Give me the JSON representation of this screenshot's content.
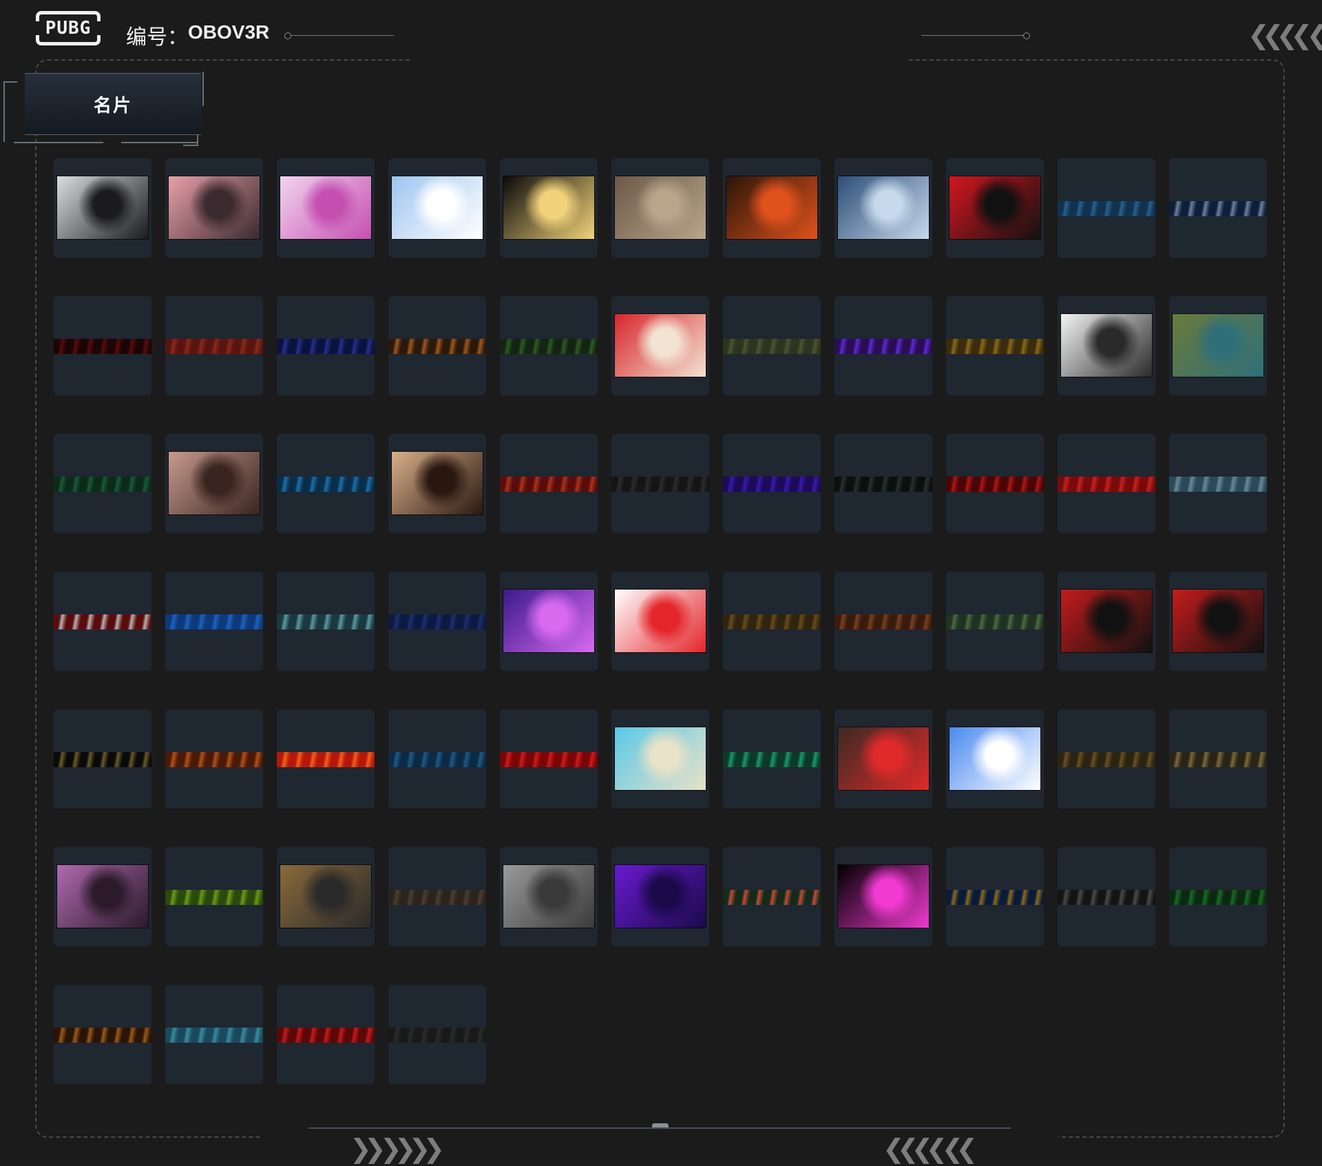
{
  "header": {
    "logo_text": "PUBG",
    "id_label": "编号：",
    "id_value": "OBOV3R",
    "top_right_chevrons": "❮❮❮❮ ❮"
  },
  "tab": {
    "label": "名片"
  },
  "footer": {
    "left_chevrons": "❯❯ ❯❯❯❯",
    "right_chevrons": "❮❮❮❮ ❮❮"
  },
  "cards": [
    {
      "style": "full",
      "colors": [
        "#d9dde0",
        "#1a1a1f"
      ],
      "icon": "girl-portrait"
    },
    {
      "style": "full",
      "colors": [
        "#e8a0a8",
        "#3b2a2f"
      ],
      "icon": "pink-hair-portrait"
    },
    {
      "style": "full",
      "colors": [
        "#f3d5ef",
        "#c44fb0"
      ],
      "icon": "flower-pattern"
    },
    {
      "style": "full",
      "colors": [
        "#9ec5f0",
        "#ffffff"
      ],
      "icon": "cartoon-fox"
    },
    {
      "style": "full",
      "colors": [
        "#0a0a0a",
        "#f2d27a"
      ],
      "icon": "anime-girls"
    },
    {
      "style": "full",
      "colors": [
        "#6b5a48",
        "#b9a58a"
      ],
      "icon": "soldier-gun"
    },
    {
      "style": "full",
      "colors": [
        "#2a1608",
        "#e0521d"
      ],
      "icon": "glowing-fruit"
    },
    {
      "style": "full",
      "colors": [
        "#2c4e78",
        "#c7d9ec"
      ],
      "icon": "snow-village"
    },
    {
      "style": "full",
      "colors": [
        "#d4161f",
        "#111111"
      ],
      "icon": "chained-wolf"
    },
    {
      "style": "strip",
      "colors": [
        "#0f3350",
        "#2a6088"
      ]
    },
    {
      "style": "strip",
      "colors": [
        "#0d1f3a",
        "#6f7f9c"
      ]
    },
    {
      "style": "strip",
      "colors": [
        "#1a0606",
        "#5c0b0b"
      ]
    },
    {
      "style": "strip",
      "colors": [
        "#5a1410",
        "#8a2a1a"
      ]
    },
    {
      "style": "strip",
      "colors": [
        "#0b1240",
        "#25308a"
      ]
    },
    {
      "style": "strip",
      "colors": [
        "#2a1a0c",
        "#a2561e"
      ]
    },
    {
      "style": "strip",
      "colors": [
        "#132412",
        "#2d5a22"
      ]
    },
    {
      "style": "full",
      "colors": [
        "#d8262b",
        "#f2e3d3"
      ],
      "icon": "octopus"
    },
    {
      "style": "strip",
      "colors": [
        "#2c3420",
        "#4a5530"
      ]
    },
    {
      "style": "strip",
      "colors": [
        "#2a0e55",
        "#5b2ad0"
      ]
    },
    {
      "style": "strip",
      "colors": [
        "#3a2c0c",
        "#8a6a1a"
      ]
    },
    {
      "style": "full",
      "colors": [
        "#f4f4f4",
        "#2a2a2a"
      ],
      "icon": "sketch-man-gun"
    },
    {
      "style": "full",
      "colors": [
        "#6a7a3a",
        "#2f6f7a"
      ],
      "icon": "frog-warrior"
    },
    {
      "style": "strip",
      "colors": [
        "#0c2a1a",
        "#1a5a34"
      ]
    },
    {
      "style": "full",
      "colors": [
        "#c79a8e",
        "#3a2420"
      ],
      "icon": "woman-sunglasses"
    },
    {
      "style": "strip",
      "colors": [
        "#0a2e4a",
        "#1a6fa8"
      ]
    },
    {
      "style": "full",
      "colors": [
        "#d9b08a",
        "#2a1810"
      ],
      "icon": "sniper-silhouette"
    },
    {
      "style": "strip",
      "colors": [
        "#5a0c0c",
        "#a8341c"
      ]
    },
    {
      "style": "strip",
      "colors": [
        "#151515",
        "#2c2c2c"
      ]
    },
    {
      "style": "strip",
      "colors": [
        "#1c0a5a",
        "#3a1aa8"
      ]
    },
    {
      "style": "strip",
      "colors": [
        "#0b0f10",
        "#25332c"
      ]
    },
    {
      "style": "strip",
      "colors": [
        "#4a0606",
        "#b01616"
      ]
    },
    {
      "style": "strip",
      "colors": [
        "#7a0a0a",
        "#c42222"
      ]
    },
    {
      "style": "strip",
      "colors": [
        "#2a4a5a",
        "#6a8a9a"
      ]
    },
    {
      "style": "strip",
      "colors": [
        "#5a0c0c",
        "#b8b0b0"
      ]
    },
    {
      "style": "strip",
      "colors": [
        "#0c3a7a",
        "#2160c0"
      ]
    },
    {
      "style": "strip",
      "colors": [
        "#1a3a40",
        "#5a9aa0"
      ]
    },
    {
      "style": "strip",
      "colors": [
        "#0c1a40",
        "#1c2e70"
      ]
    },
    {
      "style": "full",
      "colors": [
        "#3a1a8a",
        "#d86af0"
      ],
      "icon": "neon-car"
    },
    {
      "style": "full",
      "colors": [
        "#ffffff",
        "#e3262b"
      ],
      "icon": "rc-car"
    },
    {
      "style": "strip",
      "colors": [
        "#2e2410",
        "#6a4c1a"
      ]
    },
    {
      "style": "strip",
      "colors": [
        "#3a1a0c",
        "#7a4020"
      ]
    },
    {
      "style": "strip",
      "colors": [
        "#1f3320",
        "#4a6a44"
      ]
    },
    {
      "style": "full",
      "colors": [
        "#c41c1c",
        "#111111"
      ],
      "icon": "black-wolves"
    },
    {
      "style": "full",
      "colors": [
        "#c41c1c",
        "#111111"
      ],
      "icon": "good-luck-wolf"
    },
    {
      "style": "strip",
      "colors": [
        "#0a0a0a",
        "#6a5a2a"
      ]
    },
    {
      "style": "strip",
      "colors": [
        "#4a1a06",
        "#b4501c"
      ]
    },
    {
      "style": "strip",
      "colors": [
        "#b4180c",
        "#f2601a"
      ]
    },
    {
      "style": "strip",
      "colors": [
        "#0c2a44",
        "#1e5a88"
      ]
    },
    {
      "style": "strip",
      "colors": [
        "#7a0606",
        "#d01a1a"
      ]
    },
    {
      "style": "full",
      "colors": [
        "#5ac8e8",
        "#e8e2c8"
      ],
      "icon": "seagull"
    },
    {
      "style": "strip",
      "colors": [
        "#0c3a2a",
        "#1a9a6a"
      ]
    },
    {
      "style": "full",
      "colors": [
        "#3a2a22",
        "#e02a2a"
      ],
      "icon": "plague-doctor"
    },
    {
      "style": "full",
      "colors": [
        "#4a8af0",
        "#ffffff"
      ],
      "icon": "pixel-cat"
    },
    {
      "style": "strip",
      "colors": [
        "#2a2412",
        "#6a5020"
      ]
    },
    {
      "style": "strip",
      "colors": [
        "#2a2416",
        "#7a6a3a"
      ]
    },
    {
      "style": "full",
      "colors": [
        "#b06ab0",
        "#2a1a2a"
      ],
      "icon": "purple-face"
    },
    {
      "style": "strip",
      "colors": [
        "#2a4a0c",
        "#6a9a1a"
      ]
    },
    {
      "style": "full",
      "colors": [
        "#8a6a3a",
        "#2a2a2a"
      ],
      "icon": "winner-dinner"
    },
    {
      "style": "strip",
      "colors": [
        "#2a241c",
        "#4a3e30"
      ]
    },
    {
      "style": "full",
      "colors": [
        "#9a9a9a",
        "#3a3a3a"
      ],
      "icon": "static-figure"
    },
    {
      "style": "full",
      "colors": [
        "#6a1ad0",
        "#1a0a4a"
      ],
      "icon": "hooded-figure"
    },
    {
      "style": "strip",
      "colors": [
        "#142a1a",
        "#c04a3a"
      ]
    },
    {
      "style": "full",
      "colors": [
        "#000000",
        "#f03ad0"
      ],
      "icon": "equalizer"
    },
    {
      "style": "strip",
      "colors": [
        "#0c1a3a",
        "#8a6a1a"
      ]
    },
    {
      "style": "strip",
      "colors": [
        "#141414",
        "#4a4a4a"
      ]
    },
    {
      "style": "strip",
      "colors": [
        "#0c2a12",
        "#1a6a24"
      ]
    },
    {
      "style": "strip",
      "colors": [
        "#2a1406",
        "#9a5a1a"
      ]
    },
    {
      "style": "strip",
      "colors": [
        "#1a4a5a",
        "#3a8aa0"
      ]
    },
    {
      "style": "strip",
      "colors": [
        "#5a0808",
        "#c41c1c"
      ]
    },
    {
      "style": "strip",
      "colors": [
        "#181a18",
        "#2a2c2a"
      ]
    }
  ]
}
